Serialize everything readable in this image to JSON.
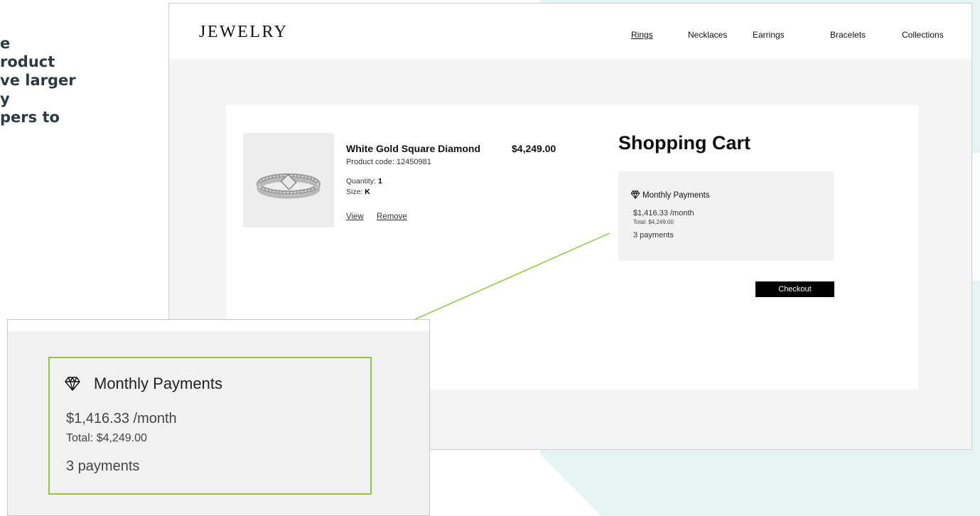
{
  "side_text": {
    "lines": [
      "e",
      "roduct",
      "ve larger",
      "y",
      "pers to"
    ]
  },
  "nav": {
    "logo": "JEWELRY",
    "items": [
      "Rings",
      "Necklaces",
      "Earrings",
      "Bracelets",
      "Collections"
    ],
    "active": "Rings"
  },
  "product": {
    "title": "White Gold Square Diamond",
    "price": "$4,249.00",
    "code": "Product code: 12450981",
    "quantity_label": "Quantity: ",
    "quantity_value": "1",
    "size_label": "Size: ",
    "size_value": "K",
    "view_label": "View",
    "remove_label": "Remove",
    "image_icon": "ring-icon"
  },
  "cart": {
    "heading": "Shopping Cart",
    "payments": {
      "icon": "diamond-icon",
      "title": "Monthly Payments",
      "monthly": "$1,416.33 /month",
      "total": "Total: $4,249.00",
      "count": "3 payments"
    },
    "checkout_label": "Checkout"
  },
  "zoom": {
    "icon": "diamond-icon",
    "title": "Monthly Payments",
    "monthly": "$1,416.33 /month",
    "total": "Total: $4,249.00",
    "count": "3 payments",
    "highlight_color": "#8dc63f"
  },
  "colors": {
    "accent": "#8dc63f",
    "teal_bg": "#e6f3f3",
    "button": "#000000"
  }
}
